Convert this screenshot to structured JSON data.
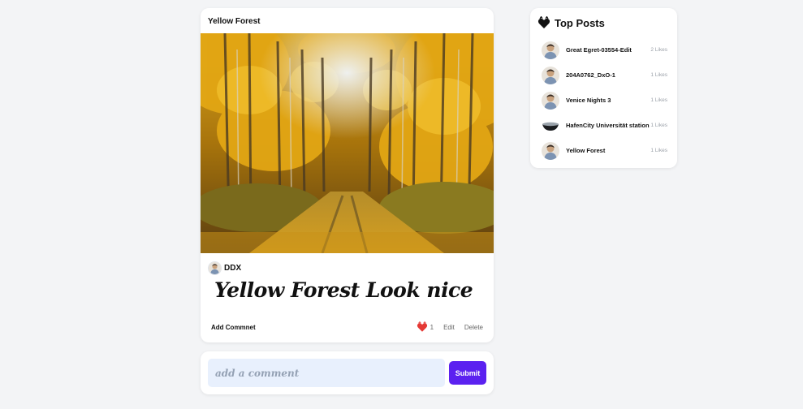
{
  "post": {
    "title": "Yellow Forest",
    "photo_icon": "forest-photo",
    "author": "DDX",
    "caption": "Yellow Forest Look nice",
    "add_comment_label": "Add Commnet",
    "like_count": "1",
    "edit_label": "Edit",
    "delete_label": "Delete",
    "heart_color": "#e53935"
  },
  "comment_form": {
    "placeholder": "add a comment",
    "submit_label": "Submit",
    "submit_color": "#5b21f0"
  },
  "top_posts": {
    "title": "Top Posts",
    "icon": "heart-icon",
    "items": [
      {
        "name": "Great Egret-03554-Edit",
        "likes": "2 Likes",
        "thumb": "person"
      },
      {
        "name": "204A0762_DxO-1",
        "likes": "1 Likes",
        "thumb": "person"
      },
      {
        "name": "Venice Nights 3",
        "likes": "1 Likes",
        "thumb": "person"
      },
      {
        "name": "HafenCity Universität station",
        "likes": "1 Likes",
        "thumb": "bowl"
      },
      {
        "name": "Yellow Forest",
        "likes": "1 Likes",
        "thumb": "person"
      }
    ]
  }
}
